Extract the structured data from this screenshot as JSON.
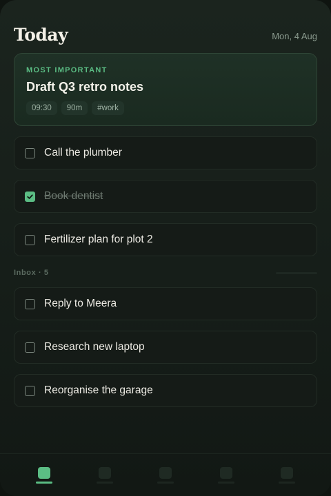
{
  "header": {
    "title": "Today",
    "date": "Mon, 4 Aug"
  },
  "featured": {
    "label": "MOST IMPORTANT",
    "title": "Draft Q3 retro notes",
    "time": "09:30",
    "duration": "90m",
    "tag": "#work"
  },
  "today_tasks": [
    {
      "label": "Call the plumber",
      "done": false
    },
    {
      "label": "Book dentist",
      "done": true
    },
    {
      "label": "Fertilizer plan for plot 2",
      "done": false
    }
  ],
  "inbox": {
    "label": "Inbox · 5",
    "tasks": [
      {
        "label": "Reply to Meera",
        "done": false
      },
      {
        "label": "Research new laptop",
        "done": false
      },
      {
        "label": "Reorganise the garage",
        "done": false
      }
    ]
  },
  "tabbar": {
    "active_index": 0,
    "icons": [
      "today-icon",
      "upcoming-icon",
      "calendar-icon",
      "projects-icon",
      "settings-icon"
    ]
  },
  "colors": {
    "accent": "#5bbd84",
    "background": "#1b241e",
    "card": "#151b17"
  }
}
